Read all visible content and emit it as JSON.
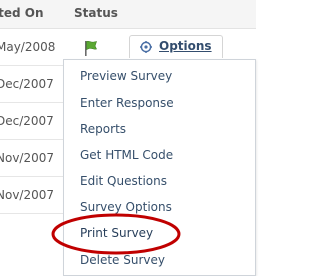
{
  "table": {
    "headers": {
      "created_on": "ated On",
      "status": "Status"
    },
    "rows": [
      {
        "created_on": "May/2008"
      },
      {
        "created_on": "Dec/2007"
      },
      {
        "created_on": "Dec/2007"
      },
      {
        "created_on": "Nov/2007"
      },
      {
        "created_on": "Nov/2007"
      }
    ]
  },
  "options_button": {
    "label": "Options",
    "icon": "gear-icon"
  },
  "status_icon": {
    "icon": "flag-icon",
    "color": "#5aa832"
  },
  "menu": {
    "items": [
      {
        "label": "Preview Survey"
      },
      {
        "label": "Enter Response"
      },
      {
        "label": "Reports"
      },
      {
        "label": "Get HTML Code"
      },
      {
        "label": "Edit Questions"
      },
      {
        "label": "Survey Options"
      },
      {
        "label": "Print Survey"
      },
      {
        "label": "Delete Survey"
      }
    ]
  },
  "annotation": {
    "shape": "ellipse",
    "color": "#c00000",
    "target": "Print Survey"
  },
  "colors": {
    "link": "#334d6e",
    "menu_border": "#cfd4da",
    "header_bg": "#f5f5f5"
  }
}
